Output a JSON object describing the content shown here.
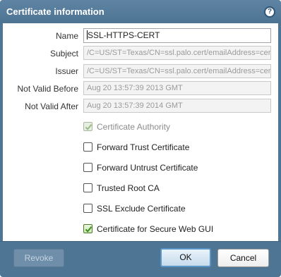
{
  "dialog": {
    "title": "Certificate information",
    "help_icon": "?"
  },
  "fields": {
    "name": {
      "label": "Name",
      "value": "SSL-HTTPS-CERT"
    },
    "subject": {
      "label": "Subject",
      "value": "/C=US/ST=Texas/CN=ssl.palo.cert/emailAddress=cert@palo.com"
    },
    "issuer": {
      "label": "Issuer",
      "value": "/C=US/ST=Texas/CN=ssl.palo.cert/emailAddress=cert@palo.com"
    },
    "not_valid_before": {
      "label": "Not Valid Before",
      "value": "Aug 20 13:57:39 2013 GMT"
    },
    "not_valid_after": {
      "label": "Not Valid After",
      "value": "Aug 20 13:57:39 2014 GMT"
    }
  },
  "checkboxes": [
    {
      "label": "Certificate Authority",
      "checked": true,
      "disabled": true
    },
    {
      "label": "Forward Trust Certificate",
      "checked": false,
      "disabled": false
    },
    {
      "label": "Forward Untrust Certificate",
      "checked": false,
      "disabled": false
    },
    {
      "label": "Trusted Root CA",
      "checked": false,
      "disabled": false
    },
    {
      "label": "SSL Exclude Certificate",
      "checked": false,
      "disabled": false
    },
    {
      "label": "Certificate for Secure Web GUI",
      "checked": true,
      "disabled": false
    }
  ],
  "buttons": {
    "revoke": "Revoke",
    "ok": "OK",
    "cancel": "Cancel"
  },
  "icons": {
    "help": "help-icon",
    "check": "checkmark-icon"
  },
  "colors": {
    "frame": "#4f7595",
    "ok_border": "#5a95c7",
    "check_green": "#3f8f1f"
  }
}
